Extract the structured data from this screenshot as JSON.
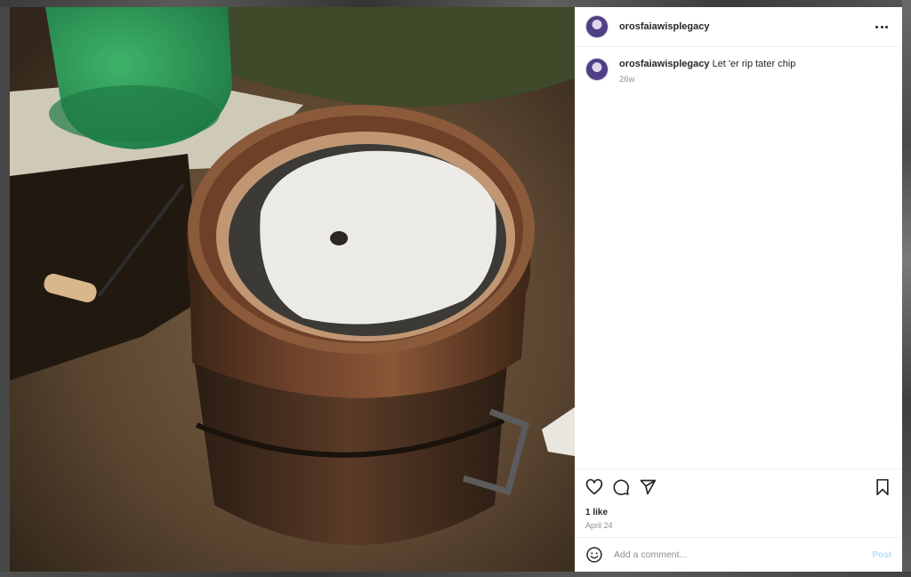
{
  "post": {
    "username": "orosfaiawisplegacy",
    "caption": "Let 'er rip tater chip",
    "time_ago": "26w",
    "likes": "1 like",
    "date": "April 24"
  },
  "comment_box": {
    "placeholder": "Add a comment...",
    "post_label": "Post"
  },
  "icons": {
    "more": "more-options-icon",
    "like": "heart-icon",
    "comment": "comment-bubble-icon",
    "share": "paper-plane-icon",
    "save": "bookmark-icon",
    "emoji": "emoji-icon"
  },
  "colors": {
    "post_button_disabled": "#b2dffc",
    "secondary_text": "#8e8e8e"
  }
}
